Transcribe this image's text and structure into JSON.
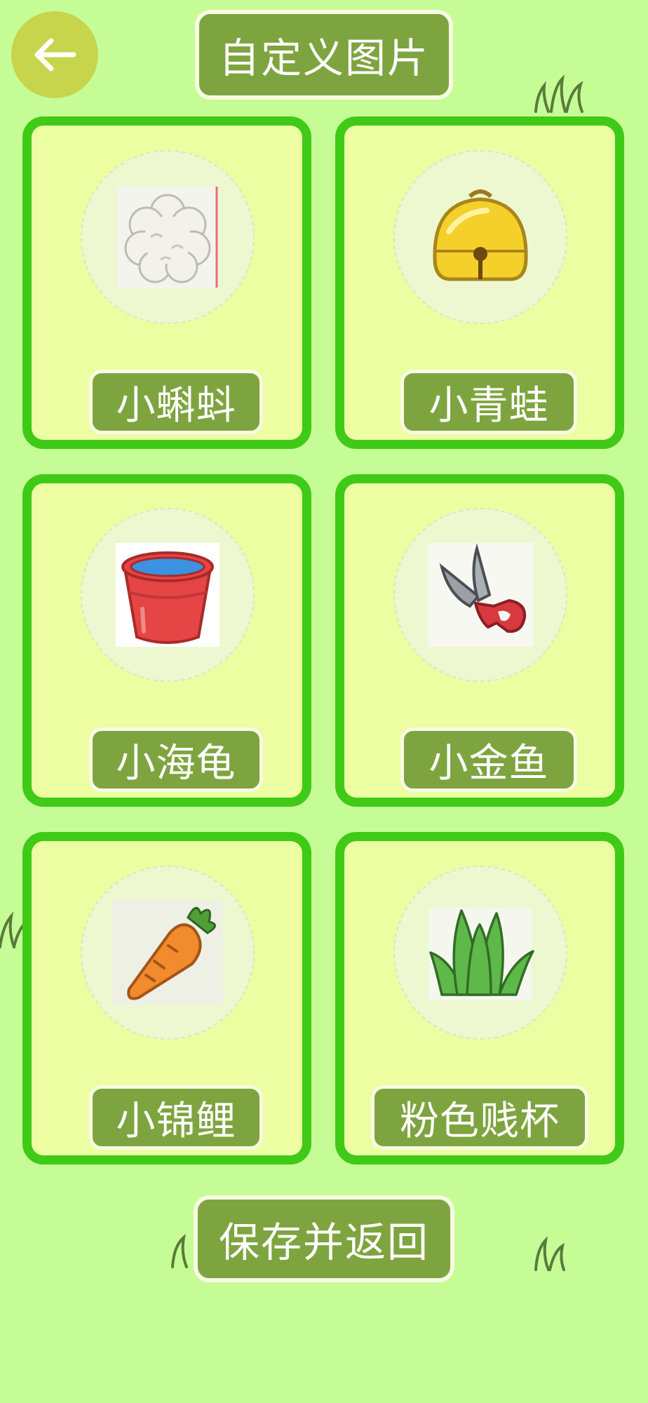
{
  "header": {
    "back_icon": "arrow-left-icon",
    "title": "自定义图片"
  },
  "cards": [
    {
      "label": "小蝌蚪",
      "image": "cotton-ball-icon"
    },
    {
      "label": "小青蛙",
      "image": "golden-bell-icon"
    },
    {
      "label": "小海龟",
      "image": "red-bucket-icon"
    },
    {
      "label": "小金鱼",
      "image": "scissors-icon"
    },
    {
      "label": "小锦鲤",
      "image": "carrot-icon"
    },
    {
      "label": "粉色贱杯",
      "image": "grass-icon"
    }
  ],
  "footer": {
    "save_label": "保存并返回"
  },
  "colors": {
    "background": "#c6fc95",
    "card_border": "#3fca17",
    "card_fill": "#ecfda2",
    "pill": "#7ea43f",
    "back_button": "#c6d54b"
  }
}
